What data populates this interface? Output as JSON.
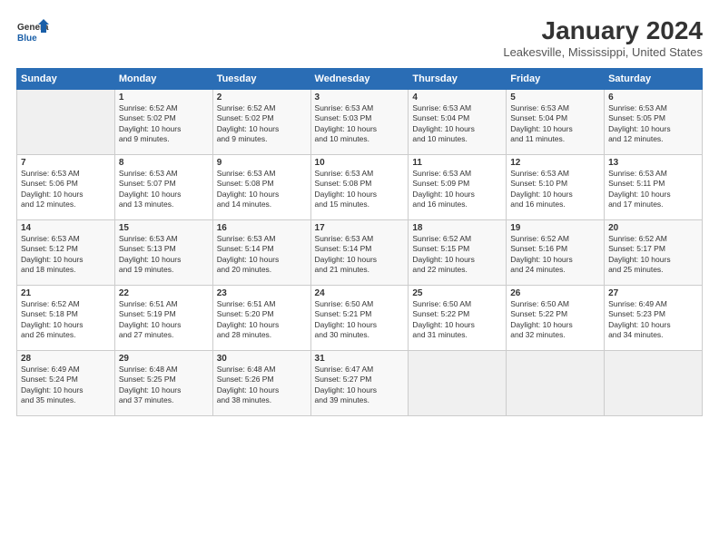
{
  "logo": {
    "line1": "General",
    "line2": "Blue"
  },
  "title": "January 2024",
  "subtitle": "Leakesville, Mississippi, United States",
  "headers": [
    "Sunday",
    "Monday",
    "Tuesday",
    "Wednesday",
    "Thursday",
    "Friday",
    "Saturday"
  ],
  "weeks": [
    [
      {
        "day": "",
        "info": ""
      },
      {
        "day": "1",
        "info": "Sunrise: 6:52 AM\nSunset: 5:02 PM\nDaylight: 10 hours\nand 9 minutes."
      },
      {
        "day": "2",
        "info": "Sunrise: 6:52 AM\nSunset: 5:02 PM\nDaylight: 10 hours\nand 9 minutes."
      },
      {
        "day": "3",
        "info": "Sunrise: 6:53 AM\nSunset: 5:03 PM\nDaylight: 10 hours\nand 10 minutes."
      },
      {
        "day": "4",
        "info": "Sunrise: 6:53 AM\nSunset: 5:04 PM\nDaylight: 10 hours\nand 10 minutes."
      },
      {
        "day": "5",
        "info": "Sunrise: 6:53 AM\nSunset: 5:04 PM\nDaylight: 10 hours\nand 11 minutes."
      },
      {
        "day": "6",
        "info": "Sunrise: 6:53 AM\nSunset: 5:05 PM\nDaylight: 10 hours\nand 12 minutes."
      }
    ],
    [
      {
        "day": "7",
        "info": "Sunrise: 6:53 AM\nSunset: 5:06 PM\nDaylight: 10 hours\nand 12 minutes."
      },
      {
        "day": "8",
        "info": "Sunrise: 6:53 AM\nSunset: 5:07 PM\nDaylight: 10 hours\nand 13 minutes."
      },
      {
        "day": "9",
        "info": "Sunrise: 6:53 AM\nSunset: 5:08 PM\nDaylight: 10 hours\nand 14 minutes."
      },
      {
        "day": "10",
        "info": "Sunrise: 6:53 AM\nSunset: 5:08 PM\nDaylight: 10 hours\nand 15 minutes."
      },
      {
        "day": "11",
        "info": "Sunrise: 6:53 AM\nSunset: 5:09 PM\nDaylight: 10 hours\nand 16 minutes."
      },
      {
        "day": "12",
        "info": "Sunrise: 6:53 AM\nSunset: 5:10 PM\nDaylight: 10 hours\nand 16 minutes."
      },
      {
        "day": "13",
        "info": "Sunrise: 6:53 AM\nSunset: 5:11 PM\nDaylight: 10 hours\nand 17 minutes."
      }
    ],
    [
      {
        "day": "14",
        "info": "Sunrise: 6:53 AM\nSunset: 5:12 PM\nDaylight: 10 hours\nand 18 minutes."
      },
      {
        "day": "15",
        "info": "Sunrise: 6:53 AM\nSunset: 5:13 PM\nDaylight: 10 hours\nand 19 minutes."
      },
      {
        "day": "16",
        "info": "Sunrise: 6:53 AM\nSunset: 5:14 PM\nDaylight: 10 hours\nand 20 minutes."
      },
      {
        "day": "17",
        "info": "Sunrise: 6:53 AM\nSunset: 5:14 PM\nDaylight: 10 hours\nand 21 minutes."
      },
      {
        "day": "18",
        "info": "Sunrise: 6:52 AM\nSunset: 5:15 PM\nDaylight: 10 hours\nand 22 minutes."
      },
      {
        "day": "19",
        "info": "Sunrise: 6:52 AM\nSunset: 5:16 PM\nDaylight: 10 hours\nand 24 minutes."
      },
      {
        "day": "20",
        "info": "Sunrise: 6:52 AM\nSunset: 5:17 PM\nDaylight: 10 hours\nand 25 minutes."
      }
    ],
    [
      {
        "day": "21",
        "info": "Sunrise: 6:52 AM\nSunset: 5:18 PM\nDaylight: 10 hours\nand 26 minutes."
      },
      {
        "day": "22",
        "info": "Sunrise: 6:51 AM\nSunset: 5:19 PM\nDaylight: 10 hours\nand 27 minutes."
      },
      {
        "day": "23",
        "info": "Sunrise: 6:51 AM\nSunset: 5:20 PM\nDaylight: 10 hours\nand 28 minutes."
      },
      {
        "day": "24",
        "info": "Sunrise: 6:50 AM\nSunset: 5:21 PM\nDaylight: 10 hours\nand 30 minutes."
      },
      {
        "day": "25",
        "info": "Sunrise: 6:50 AM\nSunset: 5:22 PM\nDaylight: 10 hours\nand 31 minutes."
      },
      {
        "day": "26",
        "info": "Sunrise: 6:50 AM\nSunset: 5:22 PM\nDaylight: 10 hours\nand 32 minutes."
      },
      {
        "day": "27",
        "info": "Sunrise: 6:49 AM\nSunset: 5:23 PM\nDaylight: 10 hours\nand 34 minutes."
      }
    ],
    [
      {
        "day": "28",
        "info": "Sunrise: 6:49 AM\nSunset: 5:24 PM\nDaylight: 10 hours\nand 35 minutes."
      },
      {
        "day": "29",
        "info": "Sunrise: 6:48 AM\nSunset: 5:25 PM\nDaylight: 10 hours\nand 37 minutes."
      },
      {
        "day": "30",
        "info": "Sunrise: 6:48 AM\nSunset: 5:26 PM\nDaylight: 10 hours\nand 38 minutes."
      },
      {
        "day": "31",
        "info": "Sunrise: 6:47 AM\nSunset: 5:27 PM\nDaylight: 10 hours\nand 39 minutes."
      },
      {
        "day": "",
        "info": ""
      },
      {
        "day": "",
        "info": ""
      },
      {
        "day": "",
        "info": ""
      }
    ]
  ]
}
